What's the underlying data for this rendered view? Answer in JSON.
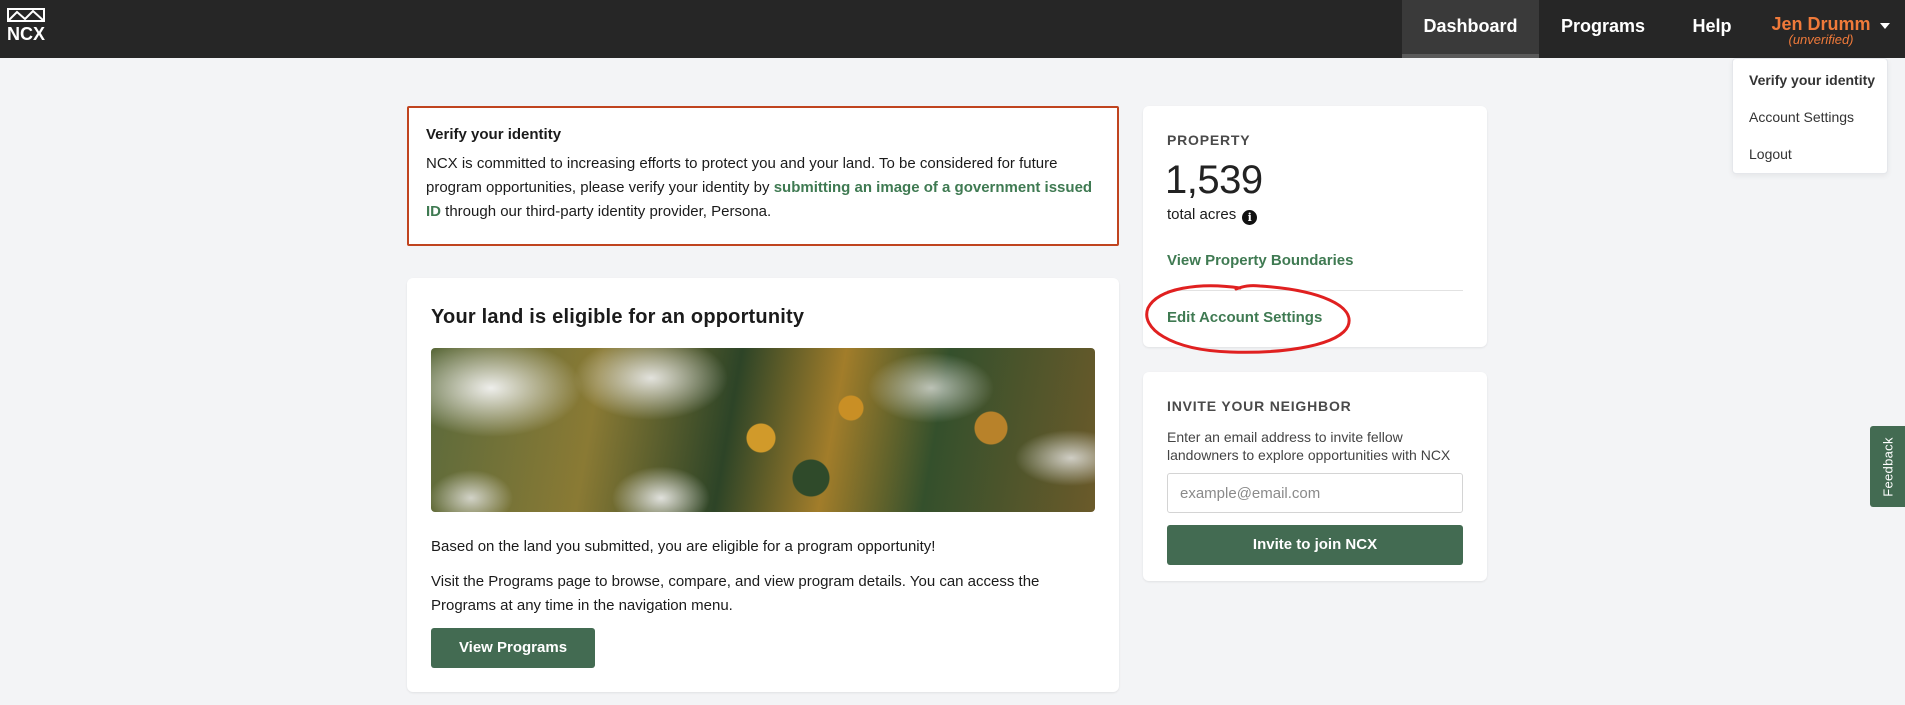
{
  "nav": {
    "logo_text": "NCX",
    "items": [
      {
        "label": "Dashboard"
      },
      {
        "label": "Programs"
      },
      {
        "label": "Help"
      }
    ],
    "user": {
      "name": "Jen Drumm",
      "status": "(unverified)"
    }
  },
  "user_dropdown": {
    "items": [
      {
        "label": "Verify your identity"
      },
      {
        "label": "Account Settings"
      },
      {
        "label": "Logout"
      }
    ]
  },
  "verify_alert": {
    "title": "Verify your identity",
    "body_before": "NCX is committed to increasing efforts to protect you and your land. To be considered for future program opportunities, please verify your identity by ",
    "link": "submitting an image of a government issued ID",
    "body_after": " through our third-party identity provider, Persona."
  },
  "opportunity": {
    "title": "Your land is eligible for an opportunity",
    "text1": "Based on the land you submitted, you are eligible for a program opportunity!",
    "text2": "Visit the Programs page to browse, compare, and view program details. You can access the Programs at any time in the navigation menu.",
    "button": "View Programs"
  },
  "property": {
    "label": "PROPERTY",
    "acres": "1,539",
    "acres_unit": "total acres",
    "info_icon": "i",
    "link_boundaries": "View Property Boundaries",
    "link_settings": "Edit Account Settings"
  },
  "invite": {
    "label": "INVITE YOUR NEIGHBOR",
    "text": "Enter an email address to invite fellow landowners to explore opportunities with NCX",
    "placeholder": "example@email.com",
    "button": "Invite to join NCX"
  },
  "feedback": {
    "label": "Feedback"
  },
  "colors": {
    "brand_green": "#436b52",
    "link_green": "#3f7a52",
    "alert_border": "#c0441f",
    "user_orange": "#f07a3a",
    "annotation_red": "#e02020"
  }
}
